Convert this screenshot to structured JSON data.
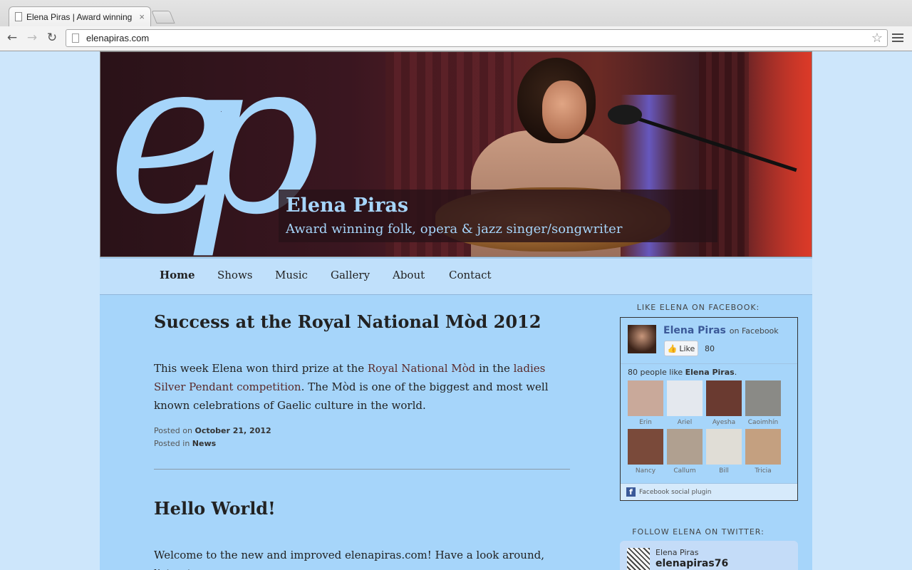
{
  "browser": {
    "tab_title": "Elena Piras | Award winning",
    "tab_close": "×",
    "url": "elenapiras.com"
  },
  "header": {
    "logo_text": "ep",
    "site_title": "Elena Piras",
    "tagline": "Award winning folk, opera & jazz singer/songwriter"
  },
  "nav": {
    "items": [
      {
        "label": "Home",
        "active": true
      },
      {
        "label": "Shows"
      },
      {
        "label": "Music"
      },
      {
        "label": "Gallery"
      },
      {
        "label": "About"
      },
      {
        "label": "Contact"
      }
    ]
  },
  "posts": [
    {
      "title": "Success at the Royal National Mòd 2012",
      "body_pre": "This week Elena won third prize at the ",
      "link1": "Royal National Mòd",
      "body_mid": " in the ",
      "link2": "ladies Silver Pendant competition",
      "body_post": ". The Mòd is one of the biggest and most well known celebrations of Gaelic culture in the world.",
      "posted_on_label": "Posted on",
      "date": "October 21, 2012",
      "posted_in_label": "Posted in",
      "category": "News"
    },
    {
      "title": "Hello World!",
      "body": "Welcome to the new and improved elenapiras.com! Have a look around, listen to"
    }
  ],
  "sidebar": {
    "facebook_heading": "LIKE ELENA ON FACEBOOK:",
    "fb_name": "Elena Piras",
    "fb_on": "on Facebook",
    "fb_like": "Like",
    "fb_count": "80",
    "fb_people_prefix": "80 people like ",
    "fb_people_name": "Elena Piras",
    "fb_people_suffix": ".",
    "fb_friends": [
      {
        "name": "Erin",
        "color": "#c9a99a"
      },
      {
        "name": "Ariel",
        "color": "#e4e8ee"
      },
      {
        "name": "Ayesha",
        "color": "#6a3a30"
      },
      {
        "name": "Caoimhín",
        "color": "#8a8a86"
      },
      {
        "name": "Nancy",
        "color": "#7a4a3a"
      },
      {
        "name": "Callum",
        "color": "#b0a090"
      },
      {
        "name": "Bill",
        "color": "#e0ddd6"
      },
      {
        "name": "Tricia",
        "color": "#c4a080"
      }
    ],
    "fb_plugin": "Facebook social plugin",
    "twitter_heading": "FOLLOW ELENA ON TWITTER:",
    "tw_name": "Elena Piras",
    "tw_handle": "elenapiras76"
  }
}
